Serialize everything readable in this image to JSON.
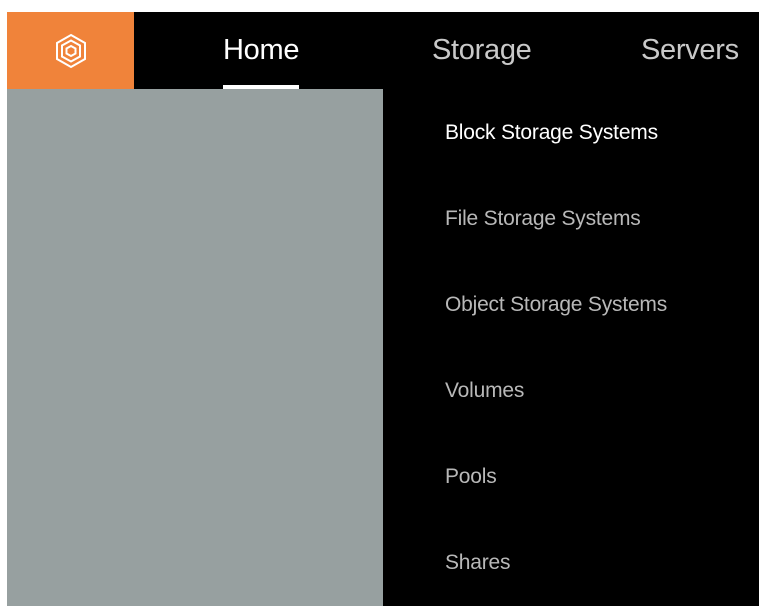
{
  "colors": {
    "background": "#000000",
    "accent": "#f0833a",
    "panel": "#97a0a0",
    "text_active": "#ffffff",
    "text_inactive": "#c9c9c9",
    "menu_text": "#b8b8b8",
    "menu_text_active": "#ffffff"
  },
  "logo": {
    "icon": "hexagon-logo-icon"
  },
  "nav": {
    "tabs": [
      {
        "label": "Home",
        "active": true
      },
      {
        "label": "Storage",
        "active": false
      },
      {
        "label": "Servers",
        "active": false
      }
    ]
  },
  "dropdown": {
    "items": [
      {
        "label": "Block Storage Systems",
        "active": true
      },
      {
        "label": "File Storage Systems",
        "active": false
      },
      {
        "label": "Object Storage Systems",
        "active": false
      },
      {
        "label": "Volumes",
        "active": false
      },
      {
        "label": "Pools",
        "active": false
      },
      {
        "label": "Shares",
        "active": false
      }
    ]
  }
}
